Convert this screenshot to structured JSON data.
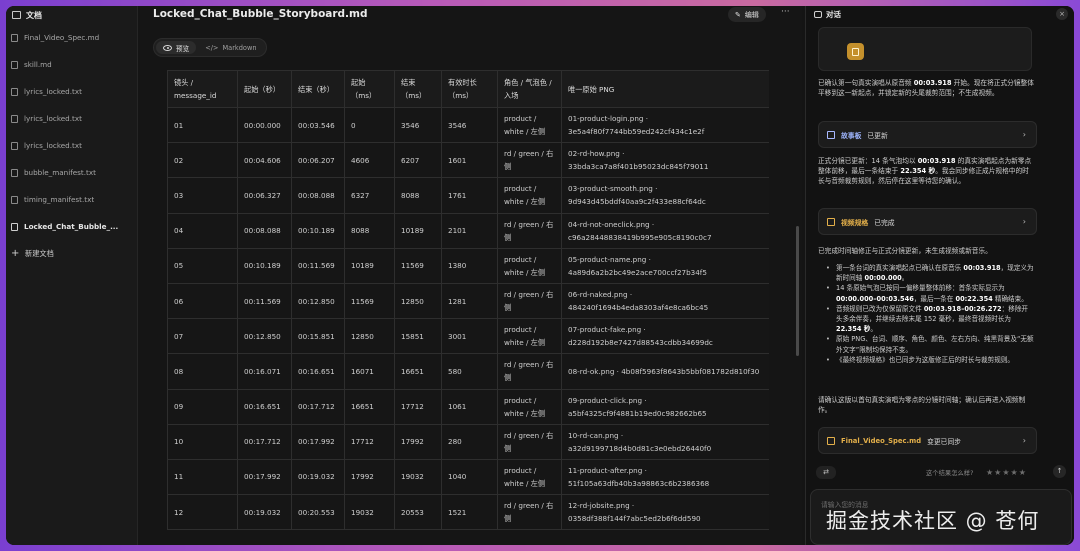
{
  "sidebar": {
    "header": "文档",
    "items": [
      {
        "label": "Final_Video_Spec.md"
      },
      {
        "label": "skill.md"
      },
      {
        "label": "lyrics_locked.txt"
      },
      {
        "label": "lyrics_locked.txt"
      },
      {
        "label": "lyrics_locked.txt"
      },
      {
        "label": "bubble_manifest.txt"
      },
      {
        "label": "timing_manifest.txt"
      },
      {
        "label": "Locked_Chat_Bubble_..."
      }
    ],
    "new_doc": "新建文档"
  },
  "document": {
    "title": "Locked_Chat_Bubble_Storyboard.md",
    "edit_label": "编辑",
    "more_label": "···",
    "tab_preview": "预览",
    "tab_markdown": "Markdown",
    "headers": [
      "镜头 / message_id",
      "起始（秒）",
      "结束（秒）",
      "起始 （ms）",
      "结束 （ms）",
      "有效时长 （ms）",
      "角色 / 气泡色 / 入场",
      "唯一原始 PNG"
    ],
    "rows": [
      [
        "01",
        "00:00.000",
        "00:03.546",
        "0",
        "3546",
        "3546",
        "product / white / 左侧",
        "01-product-login.png · 3e5a4f80f7744bb59ed242cf434c1e2f"
      ],
      [
        "02",
        "00:04.606",
        "00:06.207",
        "4606",
        "6207",
        "1601",
        "rd / green / 右侧",
        "02-rd-how.png · 33bda3ca7a8f401b95023dc845f79011"
      ],
      [
        "03",
        "00:06.327",
        "00:08.088",
        "6327",
        "8088",
        "1761",
        "product / white / 左侧",
        "03-product-smooth.png · 9d943d45bddf40aa9c2f433e88cf64dc"
      ],
      [
        "04",
        "00:08.088",
        "00:10.189",
        "8088",
        "10189",
        "2101",
        "rd / green / 右侧",
        "04-rd-not-oneclick.png · c96a28448838419b995e905c8190c0c7"
      ],
      [
        "05",
        "00:10.189",
        "00:11.569",
        "10189",
        "11569",
        "1380",
        "product / white / 左侧",
        "05-product-name.png · 4a89d6a2b2bc49e2ace700ccf27b34f5"
      ],
      [
        "06",
        "00:11.569",
        "00:12.850",
        "11569",
        "12850",
        "1281",
        "rd / green / 右侧",
        "06-rd-naked.png · 484240f1694b4eda8303af4e8ca6bc45"
      ],
      [
        "07",
        "00:12.850",
        "00:15.851",
        "12850",
        "15851",
        "3001",
        "product / white / 左侧",
        "07-product-fake.png · d228d192b8e7427d88543cdbb34699dc"
      ],
      [
        "08",
        "00:16.071",
        "00:16.651",
        "16071",
        "16651",
        "580",
        "rd / green / 右侧",
        "08-rd-ok.png · 4b08f5963f8643b5bbf081782d810f30"
      ],
      [
        "09",
        "00:16.651",
        "00:17.712",
        "16651",
        "17712",
        "1061",
        "product / white / 左侧",
        "09-product-click.png · a5bf4325cf9f4881b19ed0c982662b65"
      ],
      [
        "10",
        "00:17.712",
        "00:17.992",
        "17712",
        "17992",
        "280",
        "rd / green / 右侧",
        "10-rd-can.png · a32d9199718d4b0d81c3e0ebd26440f0"
      ],
      [
        "11",
        "00:17.992",
        "00:19.032",
        "17992",
        "19032",
        "1040",
        "product / white / 左侧",
        "11-product-after.png · 51f105a63dfb40b3a98863c6b2386368"
      ],
      [
        "12",
        "00:19.032",
        "00:20.553",
        "19032",
        "20553",
        "1521",
        "rd / green / 右侧",
        "12-rd-jobsite.png · 0358df388f144f7abc5ed2b6f6dd590"
      ]
    ]
  },
  "chat": {
    "title": "对话",
    "close": "×",
    "msg1_a": "已确认第一句真实演唱从原音频 ",
    "msg1_b": "00:03.918",
    "msg1_c": " 开始。现在将正式分镜整体平移到这一新起点，并锁定新的头尾裁剪范围；不生成视频。",
    "card1_name": "故事板",
    "card1_status": "已更新",
    "msg2_a": "正式分镜已更新：14 条气泡均以 ",
    "msg2_b": "00:03.918",
    "msg2_c": " 的真实演唱起点为新零点整体前移，最后一条结束于 ",
    "msg2_d": "22.354 秒",
    "msg2_e": "。我会同步修正成片规格中的时长与音频裁剪规则，然后停在这里等待您的确认。",
    "card2_name": "视频规格",
    "card2_status": "已完成",
    "msg3": "已完成时间轴修正与正式分镜更新，未生成视频或新音乐。",
    "bullets": [
      {
        "a": "第一条台词的真实演唱起点已确认在原音乐 ",
        "b": "00:03.918",
        "c": "，现定义为新时间轴 ",
        "d": "00:00.000",
        "e": "。"
      },
      {
        "a": "14 条原始气泡已按同一偏移量整体前移：首条实际显示为 ",
        "b": "00:00.000–00:03.546",
        "c": "，最后一条在 ",
        "d": "00:22.354",
        "e": " 精确结束。"
      },
      {
        "a": "音频规则已改为仅保留原文件 ",
        "b": "00:03.918–00:26.272",
        "c": "：移除开头多余伴奏，并继续去除末尾 152 毫秒，最终音视频时长为 ",
        "d": "22.354 秒",
        "e": "。"
      },
      {
        "a": "原始 PNG、台词、顺序、角色、颜色、左右方向、纯黑背景及“无额外文字”限制均保持不变。",
        "b": "",
        "c": "",
        "d": "",
        "e": ""
      },
      {
        "a": "《最终视频规格》也已同步为这版修正后的时长与裁剪规则。",
        "b": "",
        "c": "",
        "d": "",
        "e": ""
      }
    ],
    "msg4": "请确认这版以首句真实演唱为零点的分镜时间轴；确认后再进入视频制作。",
    "card3_name": "Final_Video_Spec.md",
    "card3_status": "变更已同步",
    "feedback_q": "这个结果怎么样?",
    "stars": "★★★★★",
    "input_placeholder": "请输入您的消息",
    "send_label": "发During"
  },
  "watermark": "掘金技术社区 @ 苍何",
  "colors": {
    "accent_gold": "#e4b04a",
    "accent_blue": "#9fb6ff",
    "background": "#141414"
  }
}
